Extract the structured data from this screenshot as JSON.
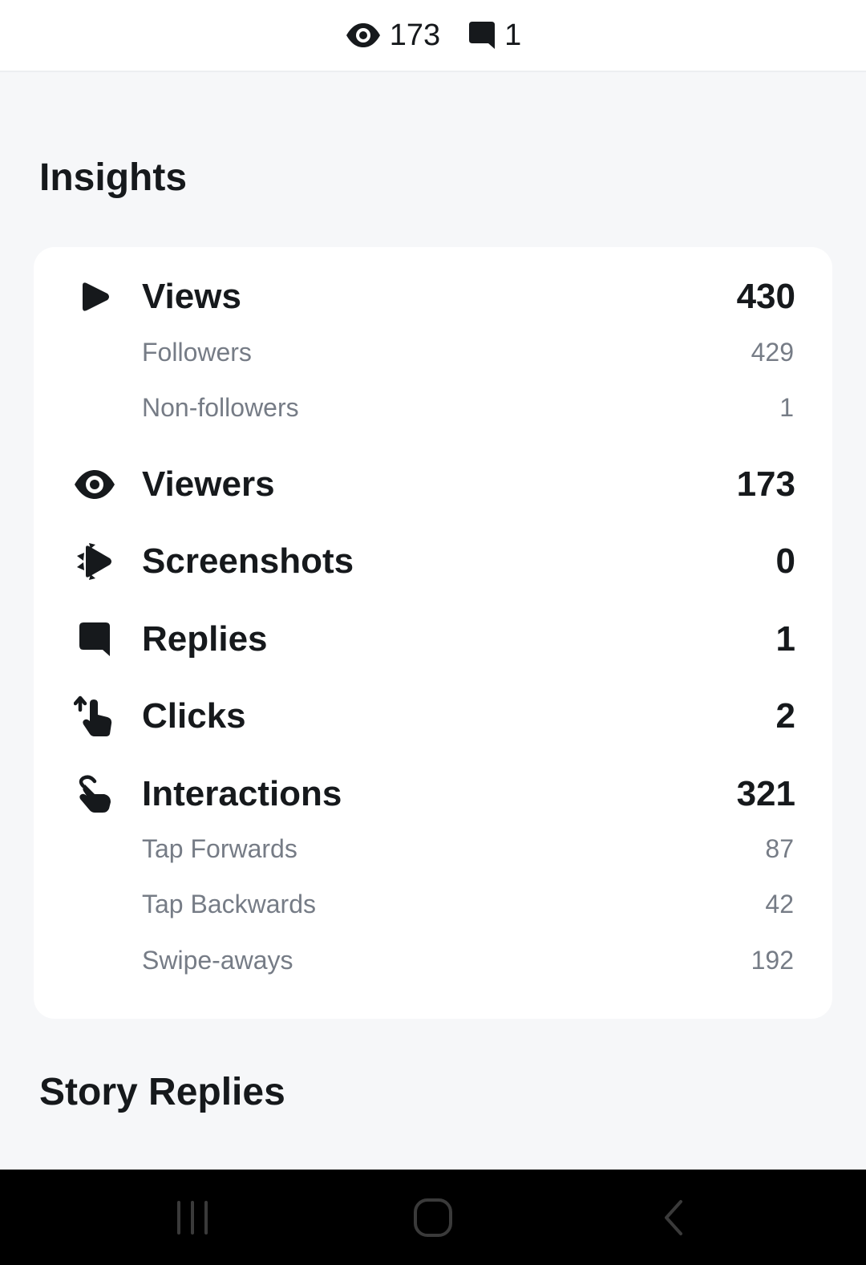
{
  "header": {
    "viewers_count": "173",
    "replies_count": "1"
  },
  "insights": {
    "title": "Insights",
    "metrics": [
      {
        "label": "Views",
        "value": "430",
        "icon": "play-icon",
        "breakdown": [
          {
            "label": "Followers",
            "value": "429"
          },
          {
            "label": "Non-followers",
            "value": "1"
          }
        ]
      },
      {
        "label": "Viewers",
        "value": "173",
        "icon": "eye-icon"
      },
      {
        "label": "Screenshots",
        "value": "0",
        "icon": "screenshot-icon"
      },
      {
        "label": "Replies",
        "value": "1",
        "icon": "chat-bubble-icon"
      },
      {
        "label": "Clicks",
        "value": "2",
        "icon": "swipe-up-hand-icon"
      },
      {
        "label": "Interactions",
        "value": "321",
        "icon": "tap-hand-icon",
        "breakdown": [
          {
            "label": "Tap Forwards",
            "value": "87"
          },
          {
            "label": "Tap Backwards",
            "value": "42"
          },
          {
            "label": "Swipe-aways",
            "value": "192"
          }
        ]
      }
    ]
  },
  "story_replies": {
    "title": "Story Replies"
  },
  "system_nav": {
    "buttons": [
      "recent-apps-icon",
      "home-icon",
      "back-icon"
    ]
  },
  "colors": {
    "background": "#f6f7f9",
    "card": "#ffffff",
    "primary_text": "#16191c",
    "secondary_text": "#767c86",
    "nav_bar": "#000000",
    "nav_icon": "#3a3a3a"
  }
}
